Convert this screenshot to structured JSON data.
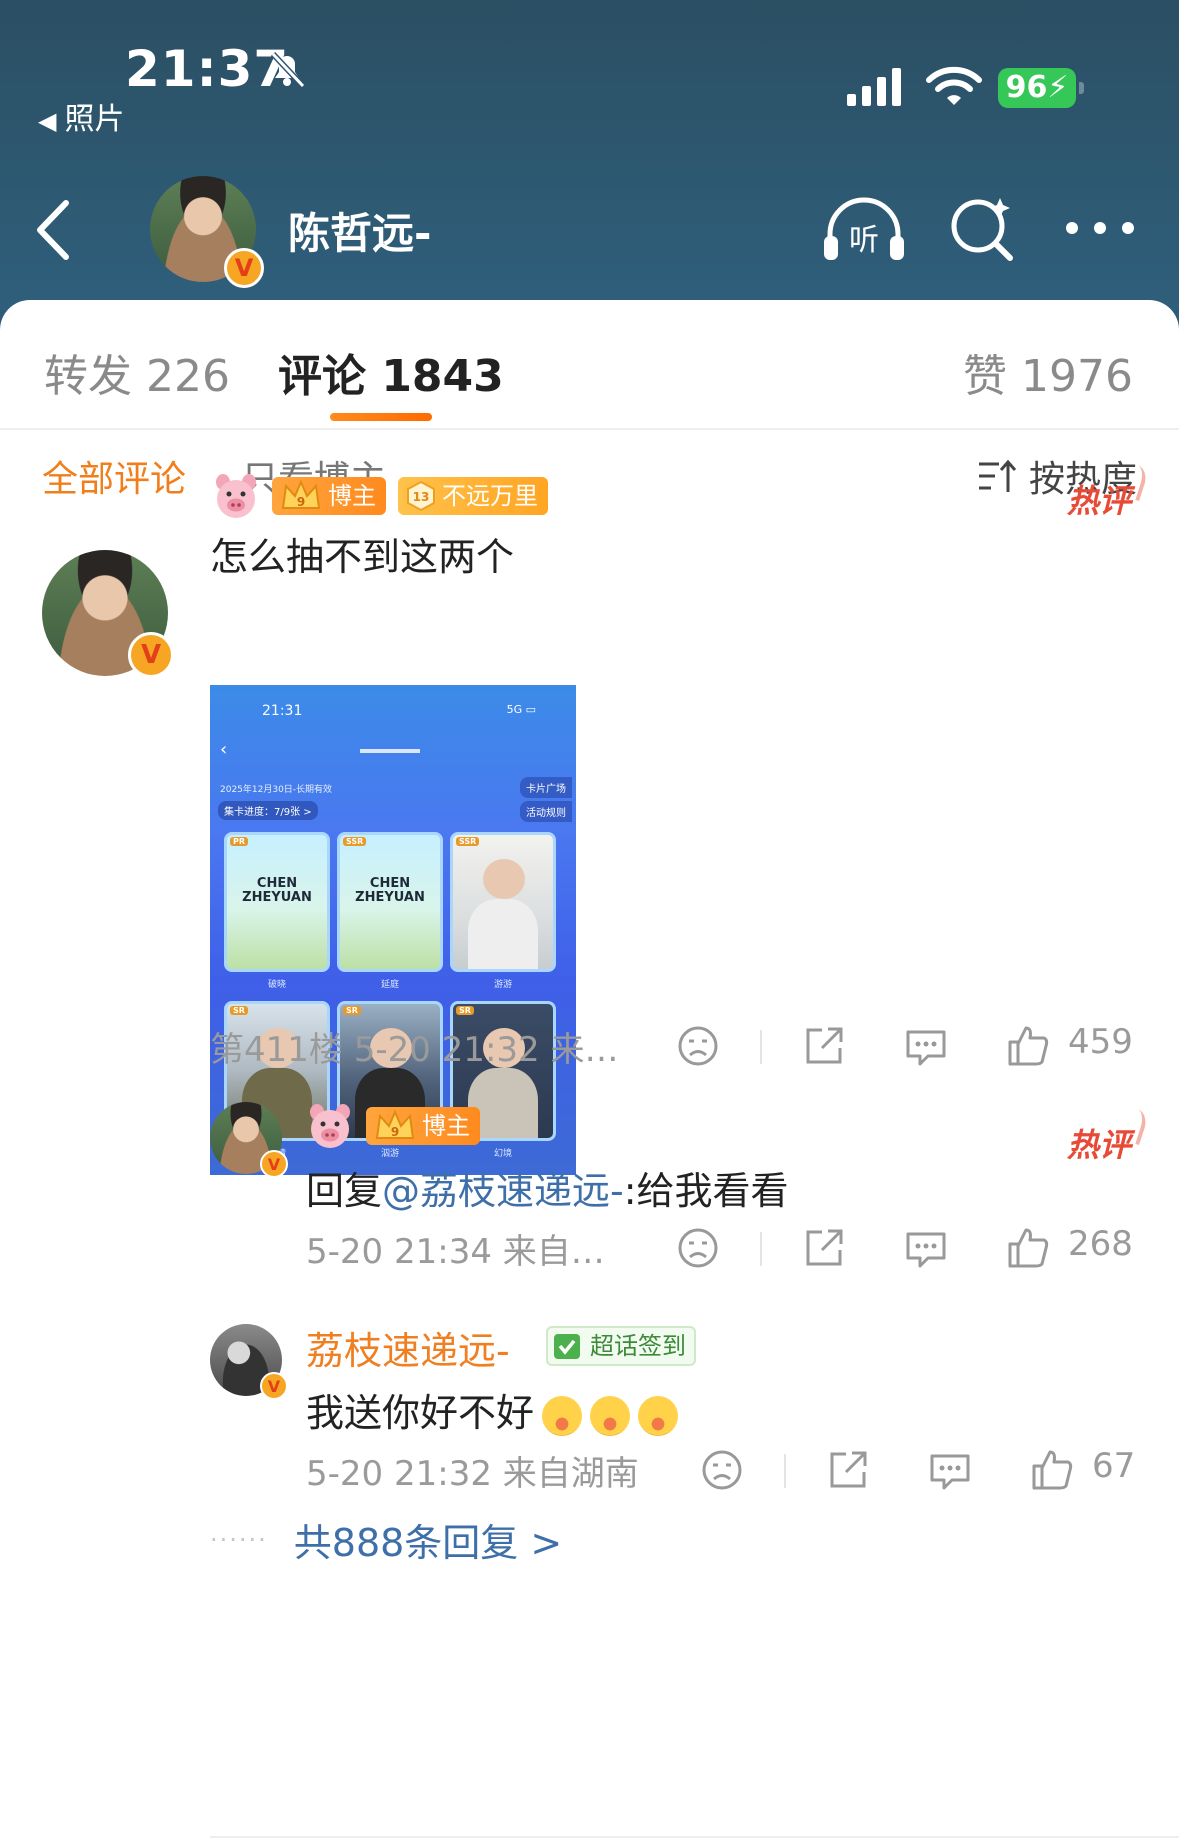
{
  "status_bar": {
    "time": "21:37",
    "back_app": "照片",
    "battery": "96",
    "icons": [
      "bell-slash-icon",
      "signal-icon",
      "wifi-icon"
    ]
  },
  "nav": {
    "title": "陈哲远-",
    "listen_label": "听",
    "icons": [
      "back-chevron-icon",
      "listen-icon",
      "search-icon",
      "more-icon"
    ]
  },
  "tabs": {
    "repost": "转发 226",
    "comment": "评论 1843",
    "like": "赞 1976",
    "active": "comment"
  },
  "filters": {
    "all": "全部评论",
    "blogger_only": "只看博主",
    "sort": "按热度"
  },
  "comment": {
    "blogger_tag": "博主",
    "fan_level": "13",
    "fan_tag": "不远万里",
    "hot_label": "热评",
    "text": "怎么抽不到这两个",
    "meta": "第411楼 5-20 21:32 来…",
    "likes": "459",
    "image": {
      "time": "21:31",
      "signal": "5G",
      "date_note": "2025年12月30日-长期有效",
      "progress": "集卡进度：7/9张 >",
      "card_plaza": "卡片广场",
      "rules": "活动规则",
      "logo_text": "CHEN ZHEYUAN",
      "rarities": [
        "PR",
        "SSR",
        "SSR",
        "SR",
        "SR",
        "SR"
      ],
      "captions": [
        "破晓",
        "延庭",
        "游游",
        "初晴",
        "泅游",
        "幻境"
      ],
      "counts": [
        "12",
        "10",
        "5"
      ]
    }
  },
  "replies": [
    {
      "tag": "博主",
      "hot_label": "热评",
      "prefix": "回复",
      "mention": "@荔枝速递远-",
      "text": ":给我看看",
      "meta": "5-20 21:34 来自…",
      "likes": "268"
    },
    {
      "name": "荔枝速递远-",
      "checkin": "超话签到",
      "text": "我送你好不好",
      "meta": "5-20 21:32 来自湖南",
      "likes": "67"
    }
  ],
  "more_replies": "共888条回复 >"
}
